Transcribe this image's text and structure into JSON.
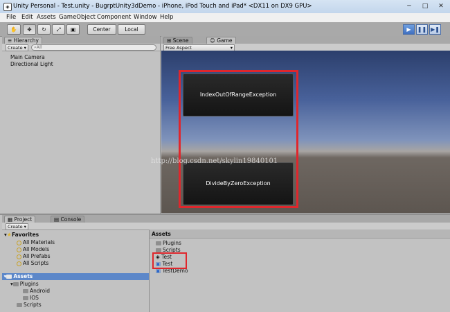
{
  "window": {
    "title": "Unity Personal - Test.unity - BugrptUnity3dDemo - iPhone, iPod Touch and iPad* <DX11 on DX9 GPU>",
    "minimize_label": "─",
    "maximize_label": "□",
    "close_label": "✕"
  },
  "menu": [
    "File",
    "Edit",
    "Assets",
    "GameObject",
    "Component",
    "Window",
    "Help"
  ],
  "toolbar": {
    "pivot_label": "Center",
    "space_label": "Local",
    "play_icon": "play-icon",
    "pause_icon": "pause-icon",
    "step_icon": "step-icon"
  },
  "hierarchy": {
    "tab_label": "Hierarchy",
    "create_label": "Create ▾",
    "search_placeholder": "All",
    "items": [
      "Main Camera",
      "Directional Light"
    ]
  },
  "scene_tab": {
    "label": "Scene"
  },
  "game_tab": {
    "label": "Game",
    "aspect_label": "Free Aspect"
  },
  "game_view": {
    "buttons": [
      "IndexOutOfRangeException",
      "DivideByZeroException"
    ],
    "watermark": "http://blog.csdn.net/skylin19840101",
    "highlight_color": "#e0262c"
  },
  "project": {
    "tab_label": "Project",
    "console_tab_label": "Console",
    "create_label": "Create ▾",
    "favorites_label": "Favorites",
    "favorites": [
      "All Materials",
      "All Models",
      "All Prefabs",
      "All Scripts"
    ],
    "assets_label": "Assets",
    "tree": {
      "plugins": "Plugins",
      "android": "Android",
      "ios": "IOS",
      "scripts": "Scripts"
    },
    "assets_header": "Assets",
    "assets": [
      "Plugins",
      "Scripts",
      "Test",
      "Test",
      "TestDemo"
    ]
  }
}
